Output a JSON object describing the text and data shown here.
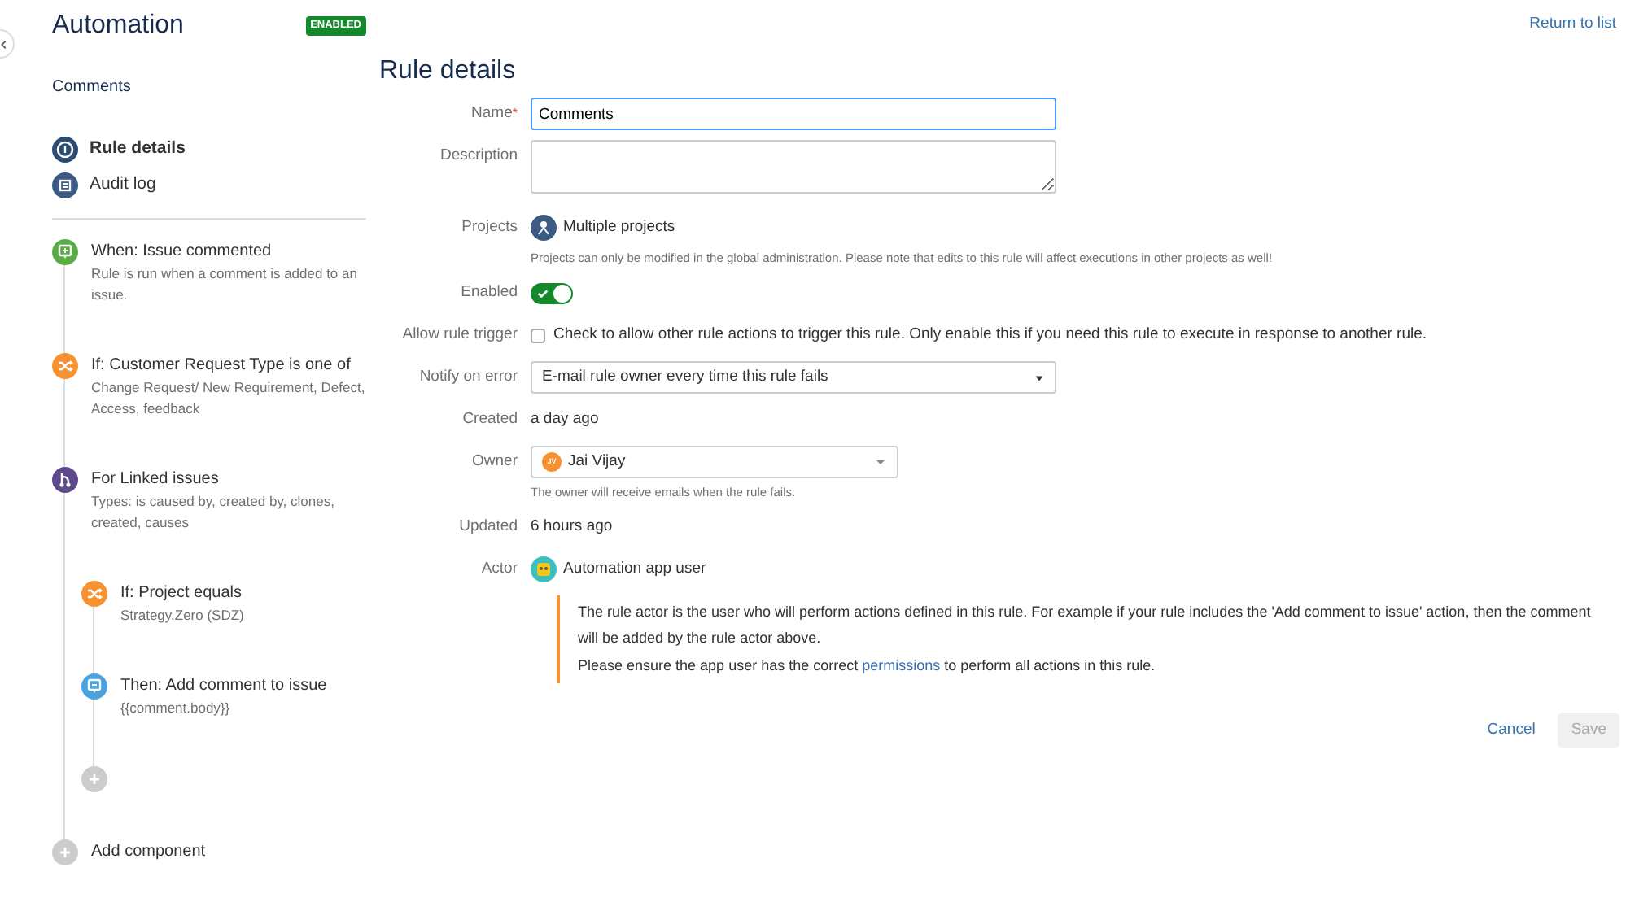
{
  "sidebar": {
    "title": "Automation",
    "status": "ENABLED",
    "rule_name": "Comments",
    "nav": [
      {
        "kind": "details",
        "label": "Rule details",
        "selected": true
      },
      {
        "kind": "log",
        "label": "Audit log",
        "selected": false
      }
    ],
    "components": [
      {
        "kind": "trigger",
        "title": "When: Issue commented",
        "subtitle": "Rule is run when a comment is added to an issue."
      },
      {
        "kind": "condition",
        "title": "If: Customer Request Type is one of",
        "subtitle": "Change Request/ New Requirement, Defect, Access, feedback"
      },
      {
        "kind": "branch",
        "title": "For Linked issues",
        "subtitle": "Types: is caused by, created by, clones, created, causes",
        "children": [
          {
            "kind": "condition",
            "title": "If: Project equals",
            "subtitle": "Strategy.Zero (SDZ)"
          },
          {
            "kind": "action",
            "title": "Then: Add comment to issue",
            "subtitle": "{{comment.body}}"
          },
          {
            "kind": "add"
          }
        ]
      },
      {
        "kind": "add",
        "title": "Add component"
      }
    ]
  },
  "return_link": "Return to list",
  "form": {
    "heading": "Rule details",
    "fields": [
      {
        "kind": "text",
        "label": "Name",
        "required_mark": "*",
        "value": "Comments"
      },
      {
        "kind": "textarea",
        "label": "Description"
      },
      {
        "kind": "project",
        "label": "Projects",
        "value": "Multiple projects",
        "help": "Projects can only be modified in the global administration. Please note that edits to this rule will affect executions in other projects as well!"
      },
      {
        "kind": "toggle",
        "label": "Enabled",
        "on": true
      },
      {
        "kind": "checkbox",
        "label": "Allow rule trigger",
        "checked": false,
        "text": "Check to allow other rule actions to trigger this rule. Only enable this if you need this rule to execute in response to another rule."
      },
      {
        "kind": "select",
        "label": "Notify on error",
        "value": "E-mail rule owner every time this rule fails"
      },
      {
        "kind": "static",
        "label": "Created",
        "value": "a day ago"
      },
      {
        "kind": "user",
        "label": "Owner",
        "initials": "JV",
        "value": "Jai Vijay",
        "help": "The owner will receive emails when the rule fails."
      },
      {
        "kind": "static",
        "label": "Updated",
        "value": "6 hours ago"
      },
      {
        "kind": "actor",
        "label": "Actor",
        "value": "Automation app user"
      }
    ],
    "note": {
      "paragraph": "The rule actor is the user who will perform actions defined in this rule. For example if your rule includes the 'Add comment to issue' action, then the comment will be added by the rule actor above.",
      "before": "Please ensure the app user has the correct ",
      "link": "permissions",
      "after": " to perform all actions in this rule."
    },
    "buttons": [
      {
        "kind": "link",
        "label": "Cancel"
      },
      {
        "kind": "primary",
        "label": "Save",
        "disabled": true
      }
    ]
  }
}
